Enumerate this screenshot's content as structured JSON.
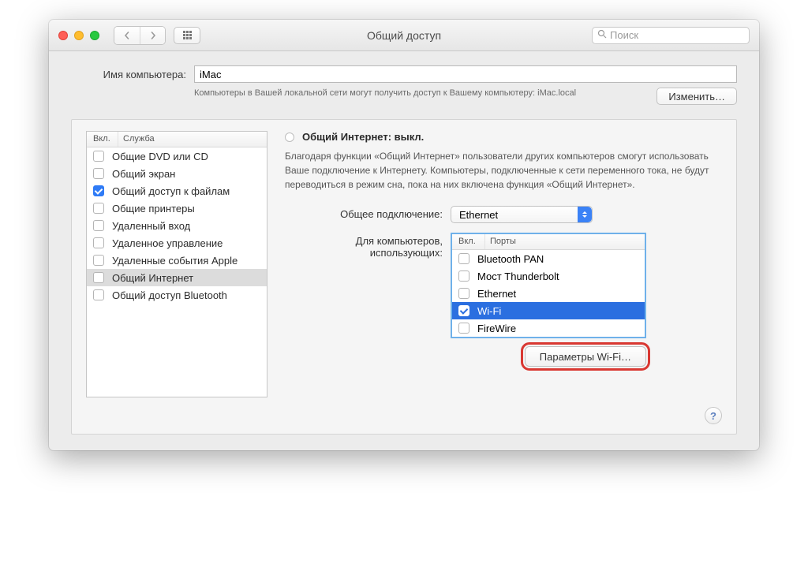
{
  "window": {
    "title": "Общий доступ"
  },
  "toolbar": {
    "search_placeholder": "Поиск"
  },
  "name_section": {
    "label": "Имя компьютера:",
    "value": "iMac",
    "description": "Компьютеры в Вашей локальной сети могут получить доступ к Вашему компьютеру: iMac.local",
    "change_button": "Изменить…"
  },
  "services": {
    "header_on": "Вкл.",
    "header_service": "Служба",
    "items": [
      {
        "label": "Общие DVD или CD",
        "checked": false
      },
      {
        "label": "Общий экран",
        "checked": false
      },
      {
        "label": "Общий доступ к файлам",
        "checked": true
      },
      {
        "label": "Общие принтеры",
        "checked": false
      },
      {
        "label": "Удаленный вход",
        "checked": false
      },
      {
        "label": "Удаленное управление",
        "checked": false
      },
      {
        "label": "Удаленные события Apple",
        "checked": false
      },
      {
        "label": "Общий Интернет",
        "checked": false,
        "selected": true
      },
      {
        "label": "Общий доступ Bluetooth",
        "checked": false
      }
    ]
  },
  "detail": {
    "status": "Общий Интернет: выкл.",
    "description": "Благодаря функции «Общий Интернет» пользователи других компьютеров смогут использовать Ваше подключение к Интернету. Компьютеры, подключенные к сети переменного тока, не будут переводиться в режим сна, пока на них включена функция «Общий Интернет».",
    "connection_label": "Общее подключение:",
    "connection_value": "Ethernet",
    "ports_label": "Для компьютеров, использующих:",
    "ports_header_on": "Вкл.",
    "ports_header_name": "Порты",
    "ports": [
      {
        "label": "Bluetooth PAN",
        "checked": false
      },
      {
        "label": "Мост Thunderbolt",
        "checked": false
      },
      {
        "label": "Ethernet",
        "checked": false
      },
      {
        "label": "Wi-Fi",
        "checked": true,
        "selected": true
      },
      {
        "label": "FireWire",
        "checked": false
      }
    ],
    "wifi_button": "Параметры Wi-Fi…"
  },
  "help": "?"
}
